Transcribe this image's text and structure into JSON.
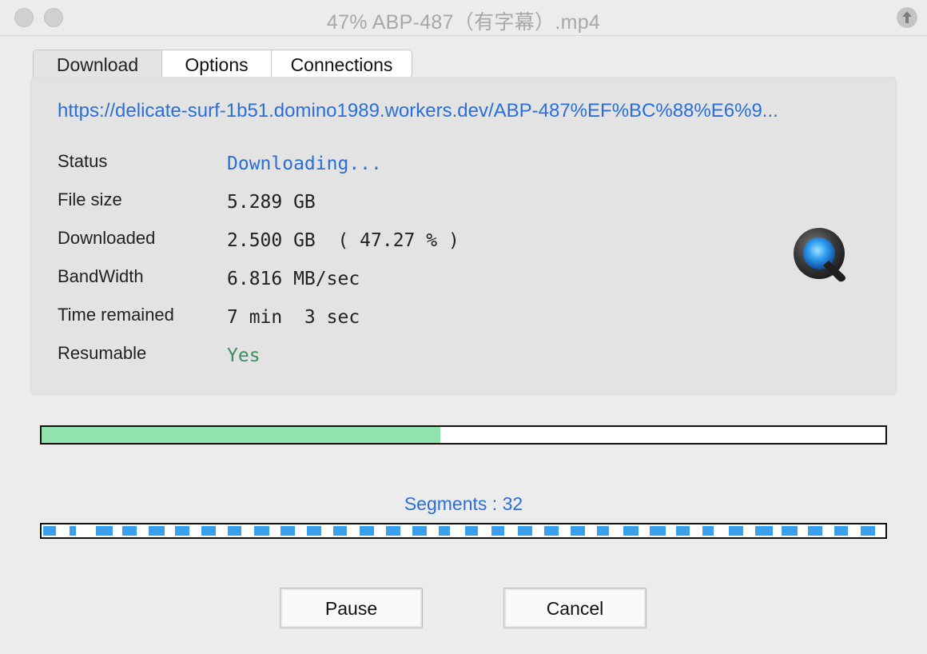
{
  "window": {
    "title": "47%  ABP-487（有字幕）.mp4"
  },
  "tabs": [
    {
      "label": "Download",
      "selected": true
    },
    {
      "label": "Options",
      "selected": false
    },
    {
      "label": "Connections",
      "selected": false
    }
  ],
  "download": {
    "url": "https://delicate-surf-1b51.domino1989.workers.dev/ABP-487%EF%BC%88%E6%9...",
    "rows": [
      {
        "label": "Status",
        "value": "Downloading..."
      },
      {
        "label": "File size",
        "value": "5.289 GB"
      },
      {
        "label": "Downloaded",
        "value": "2.500 GB  ( 47.27 % )"
      },
      {
        "label": "BandWidth",
        "value": "6.816 MB/sec"
      },
      {
        "label": "Time remained",
        "value": "7 min  3 sec"
      },
      {
        "label": "Resumable",
        "value": "Yes"
      }
    ],
    "file_icon": "quicktime-icon"
  },
  "progress": {
    "percent": 47.27,
    "fill_color": "#92e2ae"
  },
  "segments": {
    "label": "Segments : 32",
    "count": 32,
    "fill_color": "#3aa0ec",
    "fills": [
      0.55,
      0.3,
      0.7,
      0.62,
      0.66,
      0.6,
      0.6,
      0.58,
      0.64,
      0.62,
      0.6,
      0.58,
      0.62,
      0.6,
      0.6,
      0.48,
      0.56,
      0.54,
      0.6,
      0.62,
      0.6,
      0.52,
      0.64,
      0.66,
      0.58,
      0.48,
      0.6,
      0.74,
      0.66,
      0.6,
      0.58,
      0.6
    ]
  },
  "buttons": {
    "pause": "Pause",
    "cancel": "Cancel"
  },
  "colors": {
    "link_blue": "#2a6fd8",
    "yes_green": "#3a8f5e"
  }
}
